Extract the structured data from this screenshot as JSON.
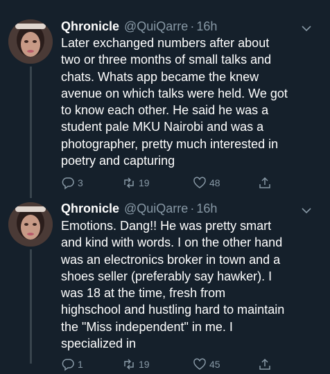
{
  "tweets": [
    {
      "display_name": "Qhronicle",
      "handle": "@QuiQarre",
      "separator": "·",
      "time": "16h",
      "text": "Later exchanged numbers after about\ntwo or three months of small talks and\nchats. Whats app became the knew\navenue on which talks were held. We got\nto know each other. He said he was a\nstudent pale MKU Nairobi and was a\nphotographer, pretty much interested in\npoetry and capturing",
      "reply_count": "3",
      "retweet_count": "19",
      "like_count": "48"
    },
    {
      "display_name": "Qhronicle",
      "handle": "@QuiQarre",
      "separator": "·",
      "time": "16h",
      "text": "Emotions. Dang!! He was pretty smart\nand kind with words. I on the other hand\nwas an electronics broker in town and a\nshoes seller (preferably say hawker). I\nwas 18 at the time, fresh from\nhighschool and hustling hard to maintain\nthe \"Miss independent\" in me. I\nspecialized in",
      "reply_count": "1",
      "retweet_count": "19",
      "like_count": "45"
    }
  ],
  "colors": {
    "background": "#15202b",
    "text": "#ffffff",
    "secondary": "#8899a6",
    "thread_line": "#38444d"
  }
}
